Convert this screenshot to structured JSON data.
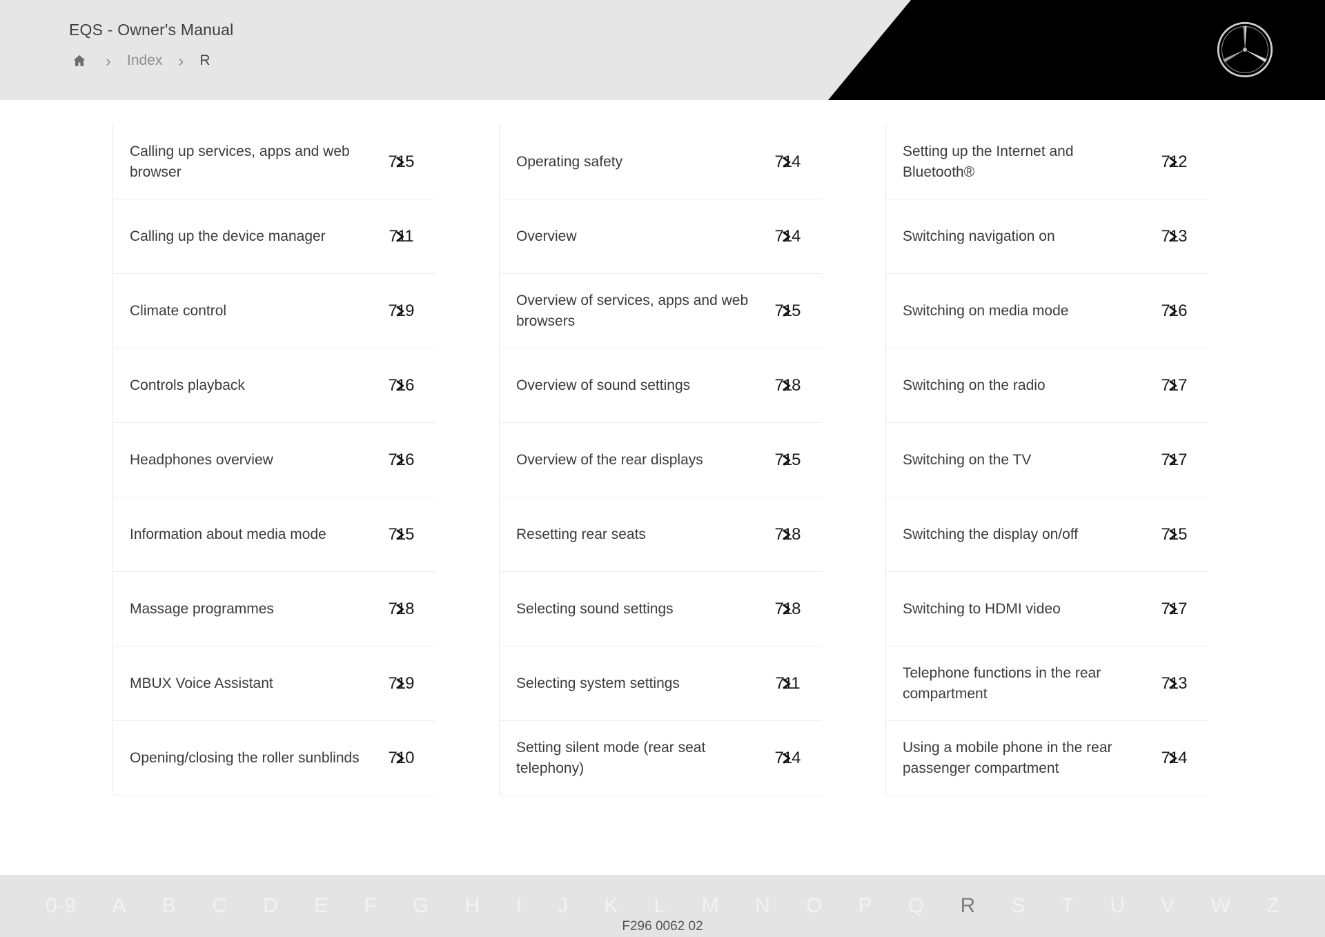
{
  "header": {
    "manual_title": "EQS - Owner's Manual",
    "home_icon": "home-icon",
    "separator": "›",
    "breadcrumb_index": "Index",
    "breadcrumb_current": "R",
    "logo": "mercedes-benz-star-logo"
  },
  "columns": [
    {
      "entries": [
        {
          "title": "Calling up services, apps and web browser",
          "page": "715",
          "page_prefix": "7",
          "page_suffix": "5"
        },
        {
          "title": "Calling up the device manager",
          "page": "711",
          "page_prefix": "7",
          "page_suffix": "1"
        },
        {
          "title": "Climate control",
          "page": "719",
          "page_prefix": "7",
          "page_suffix": "9"
        },
        {
          "title": "Controls playback",
          "page": "716",
          "page_prefix": "7",
          "page_suffix": "6"
        },
        {
          "title": "Headphones overview",
          "page": "716",
          "page_prefix": "7",
          "page_suffix": "6"
        },
        {
          "title": "Information about media mode",
          "page": "715",
          "page_prefix": "7",
          "page_suffix": "5"
        },
        {
          "title": "Massage programmes",
          "page": "718",
          "page_prefix": "7",
          "page_suffix": "8"
        },
        {
          "title": "MBUX Voice Assistant",
          "page": "719",
          "page_prefix": "7",
          "page_suffix": "9"
        },
        {
          "title": "Opening/closing the roller sunblinds",
          "page": "710",
          "page_prefix": "7",
          "page_suffix": "0"
        }
      ]
    },
    {
      "entries": [
        {
          "title": "Operating safety",
          "page": "714",
          "page_prefix": "7",
          "page_suffix": "4"
        },
        {
          "title": "Overview",
          "page": "714",
          "page_prefix": "7",
          "page_suffix": "4"
        },
        {
          "title": "Overview of services, apps and web browsers",
          "page": "715",
          "page_prefix": "7",
          "page_suffix": "5"
        },
        {
          "title": "Overview of sound settings",
          "page": "718",
          "page_prefix": "7",
          "page_suffix": "8"
        },
        {
          "title": "Overview of the rear displays",
          "page": "715",
          "page_prefix": "7",
          "page_suffix": "5"
        },
        {
          "title": "Resetting rear seats",
          "page": "718",
          "page_prefix": "7",
          "page_suffix": "8"
        },
        {
          "title": "Selecting sound settings",
          "page": "718",
          "page_prefix": "7",
          "page_suffix": "8"
        },
        {
          "title": "Selecting system settings",
          "page": "711",
          "page_prefix": "7",
          "page_suffix": "1"
        },
        {
          "title": "Setting silent mode (rear seat telephony)",
          "page": "714",
          "page_prefix": "7",
          "page_suffix": "4"
        }
      ]
    },
    {
      "entries": [
        {
          "title": "Setting up the Internet and Bluetooth®",
          "page": "712",
          "page_prefix": "7",
          "page_suffix": "2"
        },
        {
          "title": "Switching navigation on",
          "page": "713",
          "page_prefix": "7",
          "page_suffix": "3"
        },
        {
          "title": "Switching on media mode",
          "page": "716",
          "page_prefix": "7",
          "page_suffix": "6"
        },
        {
          "title": "Switching on the radio",
          "page": "717",
          "page_prefix": "7",
          "page_suffix": "7"
        },
        {
          "title": "Switching on the TV",
          "page": "717",
          "page_prefix": "7",
          "page_suffix": "7"
        },
        {
          "title": "Switching the display on/off",
          "page": "715",
          "page_prefix": "7",
          "page_suffix": "5"
        },
        {
          "title": "Switching to HDMI video",
          "page": "717",
          "page_prefix": "7",
          "page_suffix": "7"
        },
        {
          "title": "Telephone functions in the rear compartment",
          "page": "713",
          "page_prefix": "7",
          "page_suffix": "3"
        },
        {
          "title": "Using a mobile phone in the rear passenger compartment",
          "page": "714",
          "page_prefix": "7",
          "page_suffix": "4"
        }
      ]
    }
  ],
  "alphabet_bar": {
    "items": [
      {
        "label": "0-9",
        "active": false
      },
      {
        "label": "A",
        "active": false
      },
      {
        "label": "B",
        "active": false
      },
      {
        "label": "C",
        "active": false
      },
      {
        "label": "D",
        "active": false
      },
      {
        "label": "E",
        "active": false
      },
      {
        "label": "F",
        "active": false
      },
      {
        "label": "G",
        "active": false
      },
      {
        "label": "H",
        "active": false
      },
      {
        "label": "I",
        "active": false
      },
      {
        "label": "J",
        "active": false
      },
      {
        "label": "K",
        "active": false
      },
      {
        "label": "L",
        "active": false
      },
      {
        "label": "M",
        "active": false
      },
      {
        "label": "N",
        "active": false
      },
      {
        "label": "O",
        "active": false
      },
      {
        "label": "P",
        "active": false
      },
      {
        "label": "Q",
        "active": false
      },
      {
        "label": "R",
        "active": true
      },
      {
        "label": "S",
        "active": false
      },
      {
        "label": "T",
        "active": false
      },
      {
        "label": "U",
        "active": false
      },
      {
        "label": "V",
        "active": false
      },
      {
        "label": "W",
        "active": false
      },
      {
        "label": "Z",
        "active": false
      }
    ]
  },
  "footer": {
    "document_code": "F296 0062 02"
  },
  "colors": {
    "header_bg": "#e6e6e6",
    "header_accent": "#000000",
    "text_primary": "#3a3a3a",
    "text_muted": "#8f8f8f",
    "alphabet_bg": "#e4e4e4",
    "alphabet_inactive": "#f2f2f2",
    "alphabet_active": "#7d7d7d",
    "divider": "#ededed"
  }
}
